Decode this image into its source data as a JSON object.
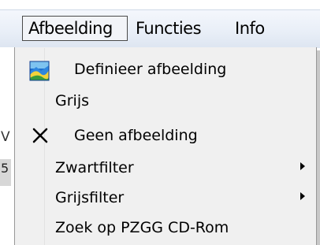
{
  "menubar": {
    "items": [
      {
        "label": "Afbeelding",
        "active": true
      },
      {
        "label": "Functies"
      },
      {
        "label": "Info"
      }
    ]
  },
  "background": {
    "fragment_v": "V",
    "fragment_5": "5"
  },
  "dropdown": {
    "items": [
      {
        "label": "Definieer afbeelding",
        "icon": "image-icon"
      },
      {
        "label": "Grijs"
      },
      {
        "label": "Geen afbeelding",
        "icon": "x-mark-icon"
      },
      {
        "label": "Zwartfilter",
        "submenu": true
      },
      {
        "label": "Grijsfilter",
        "submenu": true
      },
      {
        "label": "Zoek op PZGG CD-Rom"
      }
    ]
  },
  "colors": {
    "menubar_bg": "#e8eef7",
    "dropdown_bg": "#f0f0f0",
    "border": "#979797"
  }
}
